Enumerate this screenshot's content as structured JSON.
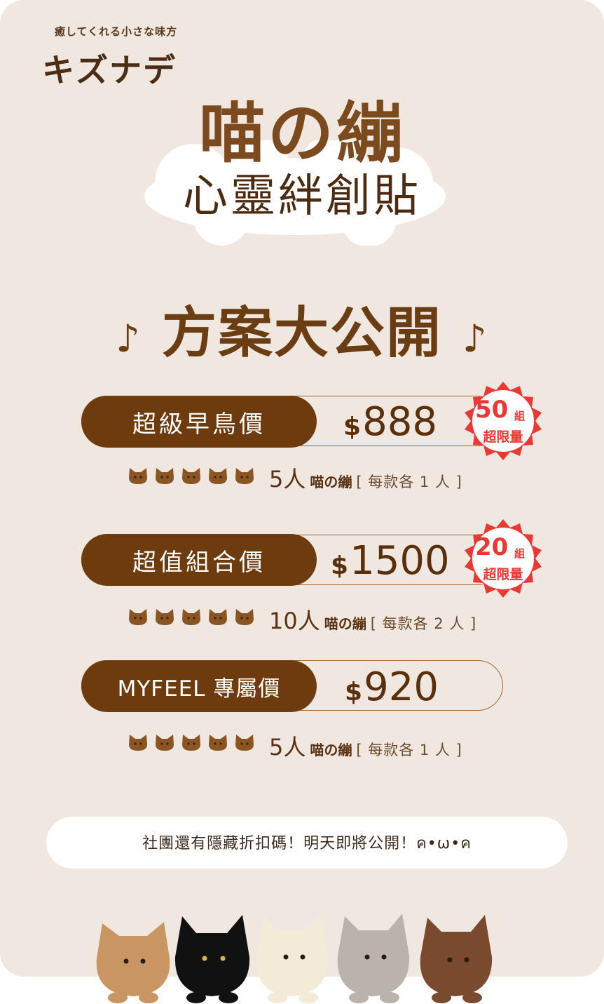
{
  "brand": {
    "tagline": "癒してくれる小さな味方",
    "name": "キズナデ"
  },
  "title": {
    "main": "喵の繃",
    "sub": "心靈絆創貼"
  },
  "headline": {
    "text": "方案大公開",
    "note_left": "♪",
    "note_right": "♪"
  },
  "plans": [
    {
      "label": "超級早鳥價",
      "currency": "$",
      "price": "888",
      "badge": {
        "num": "50",
        "unit": "組",
        "text": "超限量"
      },
      "qty": "5人",
      "product": "喵の繃",
      "detail": "[ 每款各 1 人 ]"
    },
    {
      "label": "超值組合價",
      "currency": "$",
      "price": "1500",
      "badge": {
        "num": "20",
        "unit": "組",
        "text": "超限量"
      },
      "qty": "10人",
      "product": "喵の繃",
      "detail": "[ 每款各 2 人 ]"
    },
    {
      "label": "MYFEEL 專屬價",
      "currency": "$",
      "price": "920",
      "qty": "5人",
      "product": "喵の繃",
      "detail": "[ 每款各 1 人 ]"
    }
  ],
  "banner": {
    "text": "社團還有隱藏折扣碼！明天即將公開！ค•ω•ค"
  },
  "colors": {
    "brown": "#6e3b0f",
    "background": "#f0e8e0",
    "badge_red": "#e83a34"
  },
  "plush_colors": [
    "#c99562",
    "#111111",
    "#f3ead8",
    "#b9b3ab",
    "#7a4a2e"
  ]
}
